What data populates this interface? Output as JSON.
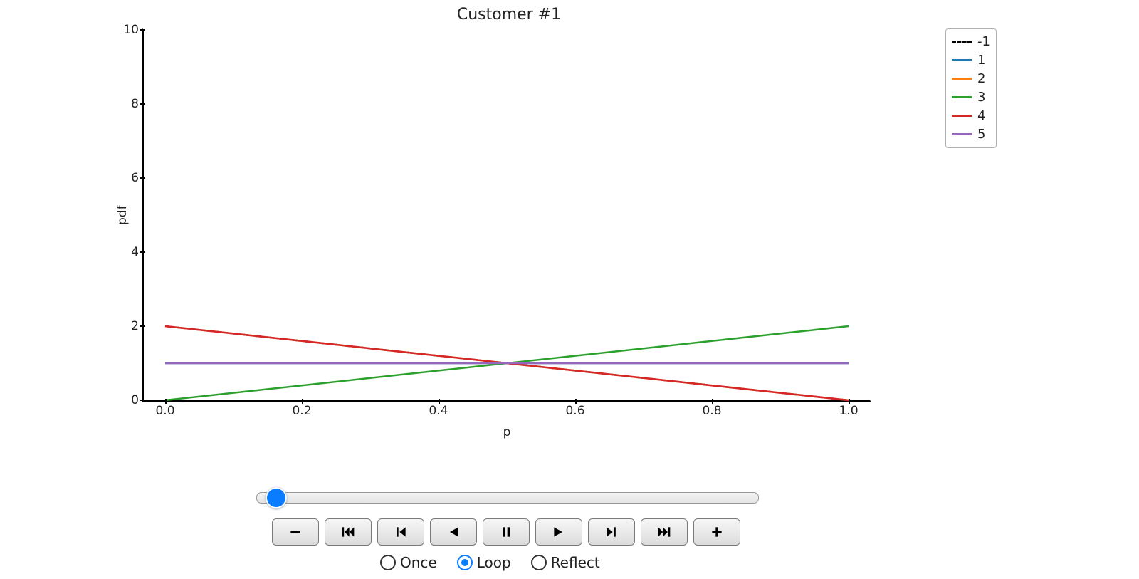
{
  "chart_data": {
    "type": "line",
    "title": "Customer #1",
    "xlabel": "p",
    "ylabel": "pdf",
    "xlim": [
      0.0,
      1.0
    ],
    "ylim": [
      0,
      10
    ],
    "x_ticks": [
      "0.0",
      "0.2",
      "0.4",
      "0.6",
      "0.8",
      "1.0"
    ],
    "y_ticks": [
      "0",
      "2",
      "4",
      "6",
      "8",
      "10"
    ],
    "x": [
      0.0,
      0.1,
      0.2,
      0.3,
      0.4,
      0.5,
      0.6,
      0.7,
      0.8,
      0.9,
      1.0
    ],
    "series": [
      {
        "name": "-1",
        "color": "#000000",
        "dash": true,
        "values": [
          2.0,
          1.8,
          1.6,
          1.4,
          1.2,
          1.0,
          0.8,
          0.6,
          0.4,
          0.2,
          0.0
        ]
      },
      {
        "name": "1",
        "color": "#1f77b4",
        "dash": false,
        "values": [
          1.0,
          1.0,
          1.0,
          1.0,
          1.0,
          1.0,
          1.0,
          1.0,
          1.0,
          1.0,
          1.0
        ]
      },
      {
        "name": "2",
        "color": "#ff7f0e",
        "dash": false,
        "values": [
          2.0,
          1.8,
          1.6,
          1.4,
          1.2,
          1.0,
          0.8,
          0.6,
          0.4,
          0.2,
          0.0
        ]
      },
      {
        "name": "3",
        "color": "#2ca02c",
        "dash": false,
        "values": [
          0.0,
          0.2,
          0.4,
          0.6,
          0.8,
          1.0,
          1.2,
          1.4,
          1.6,
          1.8,
          2.0
        ]
      },
      {
        "name": "4",
        "color": "#d62728",
        "dash": false,
        "values": [
          2.0,
          1.8,
          1.6,
          1.4,
          1.2,
          1.0,
          0.8,
          0.6,
          0.4,
          0.2,
          0.0
        ]
      },
      {
        "name": "5",
        "color": "#9467bd",
        "dash": false,
        "values": [
          1.0,
          1.0,
          1.0,
          1.0,
          1.0,
          1.0,
          1.0,
          1.0,
          1.0,
          1.0,
          1.0
        ]
      }
    ]
  },
  "controls": {
    "modes": [
      {
        "label": "Once",
        "selected": false
      },
      {
        "label": "Loop",
        "selected": true
      },
      {
        "label": "Reflect",
        "selected": false
      }
    ],
    "buttons": [
      "minus",
      "first",
      "prev",
      "reverse-play",
      "pause",
      "play",
      "next",
      "last",
      "plus"
    ]
  }
}
